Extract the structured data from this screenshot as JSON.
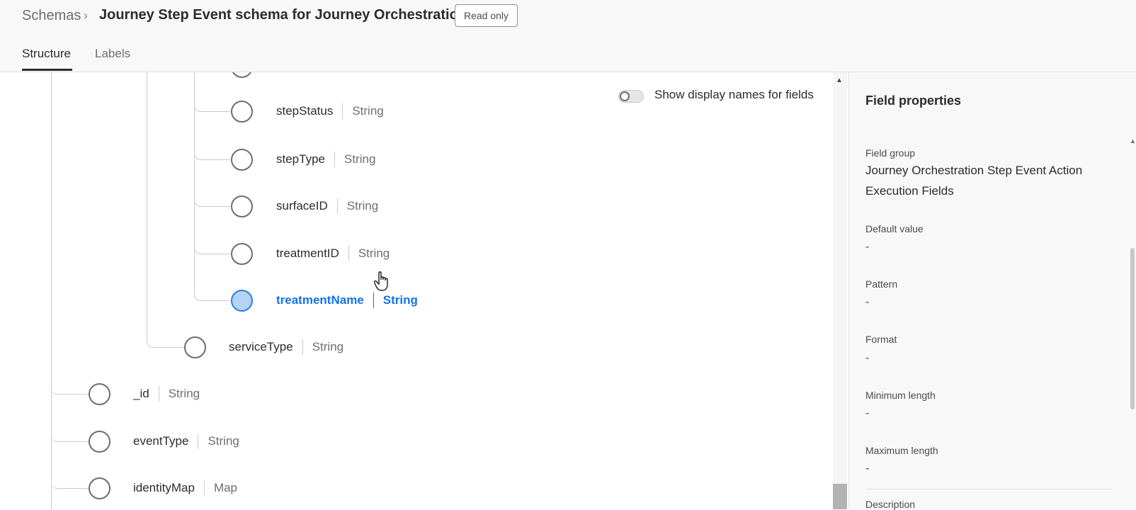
{
  "header": {
    "breadcrumb_root": "Schemas",
    "breadcrumb_separator": "›",
    "title": "Journey Step Event schema for Journey Orchestration",
    "badge": "Read only",
    "tabs": [
      {
        "label": "Structure",
        "active": true
      },
      {
        "label": "Labels",
        "active": false
      }
    ]
  },
  "tree": {
    "fields": [
      {
        "name": "stepStatus",
        "type": "String",
        "selected": false
      },
      {
        "name": "stepType",
        "type": "String",
        "selected": false
      },
      {
        "name": "surfaceID",
        "type": "String",
        "selected": false
      },
      {
        "name": "treatmentID",
        "type": "String",
        "selected": false
      },
      {
        "name": "treatmentName",
        "type": "String",
        "selected": true
      },
      {
        "name": "serviceType",
        "type": "String",
        "selected": false
      },
      {
        "name": "_id",
        "type": "String",
        "selected": false
      },
      {
        "name": "eventType",
        "type": "String",
        "selected": false
      },
      {
        "name": "identityMap",
        "type": "Map",
        "selected": false
      }
    ],
    "toggle": {
      "label": "Show display names for fields",
      "on": false
    }
  },
  "panel": {
    "title": "Field properties",
    "properties": [
      {
        "label": "Field group",
        "value": "Journey Orchestration Step Event Action Execution Fields"
      },
      {
        "label": "Default value",
        "value": "-"
      },
      {
        "label": "Pattern",
        "value": "-"
      },
      {
        "label": "Format",
        "value": "-"
      },
      {
        "label": "Minimum length",
        "value": "-"
      },
      {
        "label": "Maximum length",
        "value": "-"
      },
      {
        "label": "Description",
        "value": ""
      }
    ]
  },
  "colors": {
    "accent": "#1473e6",
    "selected_node_fill": "#b4d3f5",
    "header_bg": "#f8f8f8"
  },
  "icons": [
    "chevron-right-icon",
    "toggle-switch",
    "hand-pointer-icon",
    "scroll-up-arrow-icon"
  ]
}
